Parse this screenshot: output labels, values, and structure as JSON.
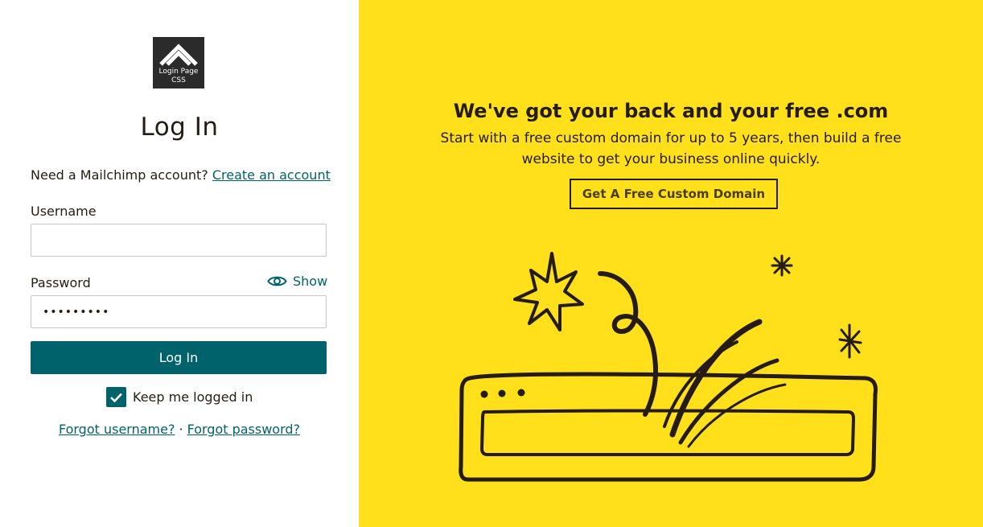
{
  "logo": {
    "line1": "Login Page",
    "line2": "CSS",
    "icon": "double-chevron-up-icon"
  },
  "login": {
    "title": "Log In",
    "signup_prompt": "Need a Mailchimp account?",
    "signup_link": "Create an account",
    "username_label": "Username",
    "username_value": "",
    "password_label": "Password",
    "password_value": "•••••••••",
    "show_label": "Show",
    "submit_label": "Log In",
    "keep_logged_in_label": "Keep me logged in",
    "keep_logged_in_checked": true,
    "forgot_username": "Forgot username?",
    "separator": "·",
    "forgot_password": "Forgot password?"
  },
  "promo": {
    "title": "We've got your back and your free .com",
    "text": "Start with a free custom domain for up to 5 years, then build a free website to get your business online quickly.",
    "button_label": "Get A Free Custom Domain"
  },
  "colors": {
    "accent": "#00626b",
    "promo_background": "#ffe01b",
    "text": "#241c15"
  }
}
